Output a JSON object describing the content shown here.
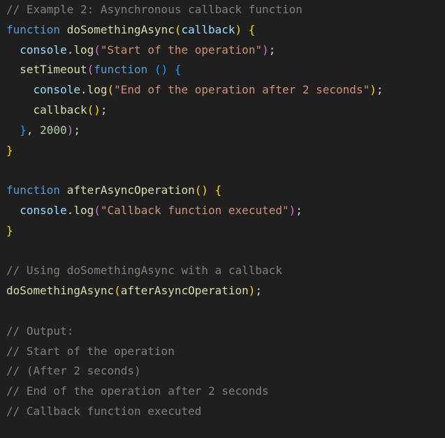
{
  "code": {
    "lines": [
      {
        "tokens": [
          {
            "t": "// Example 2: Asynchronous callback function",
            "c": "gy"
          }
        ]
      },
      {
        "tokens": [
          {
            "t": "function",
            "c": "kw"
          },
          {
            "t": " ",
            "c": "pl"
          },
          {
            "t": "doSomethingAsync",
            "c": "fn"
          },
          {
            "t": "(",
            "c": "p1"
          },
          {
            "t": "callback",
            "c": "pa"
          },
          {
            "t": ") ",
            "c": "p1"
          },
          {
            "t": "{",
            "c": "p1"
          }
        ]
      },
      {
        "tokens": [
          {
            "t": "  ",
            "c": "pl"
          },
          {
            "t": "console",
            "c": "pa"
          },
          {
            "t": ".",
            "c": "pl"
          },
          {
            "t": "log",
            "c": "fn"
          },
          {
            "t": "(",
            "c": "p2"
          },
          {
            "t": "\"Start of the operation\"",
            "c": "st"
          },
          {
            "t": ")",
            "c": "p2"
          },
          {
            "t": ";",
            "c": "pl"
          }
        ]
      },
      {
        "tokens": [
          {
            "t": "  ",
            "c": "pl"
          },
          {
            "t": "setTimeout",
            "c": "fn"
          },
          {
            "t": "(",
            "c": "p2"
          },
          {
            "t": "function",
            "c": "kw"
          },
          {
            "t": " ",
            "c": "pl"
          },
          {
            "t": "()",
            "c": "p3"
          },
          {
            "t": " ",
            "c": "pl"
          },
          {
            "t": "{",
            "c": "p3"
          }
        ]
      },
      {
        "tokens": [
          {
            "t": "    ",
            "c": "pl"
          },
          {
            "t": "console",
            "c": "pa"
          },
          {
            "t": ".",
            "c": "pl"
          },
          {
            "t": "log",
            "c": "fn"
          },
          {
            "t": "(",
            "c": "p1"
          },
          {
            "t": "\"End of the operation after 2 seconds\"",
            "c": "st"
          },
          {
            "t": ")",
            "c": "p1"
          },
          {
            "t": ";",
            "c": "pl"
          }
        ]
      },
      {
        "tokens": [
          {
            "t": "    ",
            "c": "pl"
          },
          {
            "t": "callback",
            "c": "fn"
          },
          {
            "t": "()",
            "c": "p1"
          },
          {
            "t": ";",
            "c": "pl"
          }
        ]
      },
      {
        "tokens": [
          {
            "t": "  ",
            "c": "pl"
          },
          {
            "t": "}",
            "c": "p3"
          },
          {
            "t": ", ",
            "c": "pl"
          },
          {
            "t": "2000",
            "c": "nu"
          },
          {
            "t": ")",
            "c": "p2"
          },
          {
            "t": ";",
            "c": "pl"
          }
        ]
      },
      {
        "tokens": [
          {
            "t": "}",
            "c": "p1"
          }
        ]
      },
      {
        "tokens": []
      },
      {
        "tokens": [
          {
            "t": "function",
            "c": "kw"
          },
          {
            "t": " ",
            "c": "pl"
          },
          {
            "t": "afterAsyncOperation",
            "c": "fn"
          },
          {
            "t": "()",
            "c": "p1"
          },
          {
            "t": " ",
            "c": "pl"
          },
          {
            "t": "{",
            "c": "p1"
          }
        ]
      },
      {
        "tokens": [
          {
            "t": "  ",
            "c": "pl"
          },
          {
            "t": "console",
            "c": "pa"
          },
          {
            "t": ".",
            "c": "pl"
          },
          {
            "t": "log",
            "c": "fn"
          },
          {
            "t": "(",
            "c": "p2"
          },
          {
            "t": "\"Callback function executed\"",
            "c": "st"
          },
          {
            "t": ")",
            "c": "p2"
          },
          {
            "t": ";",
            "c": "pl"
          }
        ]
      },
      {
        "tokens": [
          {
            "t": "}",
            "c": "p1"
          }
        ]
      },
      {
        "tokens": []
      },
      {
        "tokens": [
          {
            "t": "// Using doSomethingAsync with a callback",
            "c": "gy"
          }
        ]
      },
      {
        "tokens": [
          {
            "t": "doSomethingAsync",
            "c": "fn"
          },
          {
            "t": "(",
            "c": "p1"
          },
          {
            "t": "afterAsyncOperation",
            "c": "fn"
          },
          {
            "t": ")",
            "c": "p1"
          },
          {
            "t": ";",
            "c": "pl"
          }
        ]
      },
      {
        "tokens": []
      },
      {
        "tokens": [
          {
            "t": "// Output:",
            "c": "gy"
          }
        ]
      },
      {
        "tokens": [
          {
            "t": "// Start of the operation",
            "c": "gy"
          }
        ]
      },
      {
        "tokens": [
          {
            "t": "// (After 2 seconds)",
            "c": "gy"
          }
        ]
      },
      {
        "tokens": [
          {
            "t": "// End of the operation after 2 seconds",
            "c": "gy"
          }
        ]
      },
      {
        "tokens": [
          {
            "t": "// Callback function executed",
            "c": "gy"
          }
        ]
      }
    ]
  },
  "colors": {
    "background": "#1f1f1f",
    "comment": "#808080",
    "keyword": "#569cd6",
    "function": "#dcdcaa",
    "variable": "#9cdcfe",
    "string": "#ce9178",
    "number": "#b5cea8",
    "bracket_1": "#ffd700",
    "bracket_2": "#da70d6",
    "bracket_3": "#179fff"
  }
}
